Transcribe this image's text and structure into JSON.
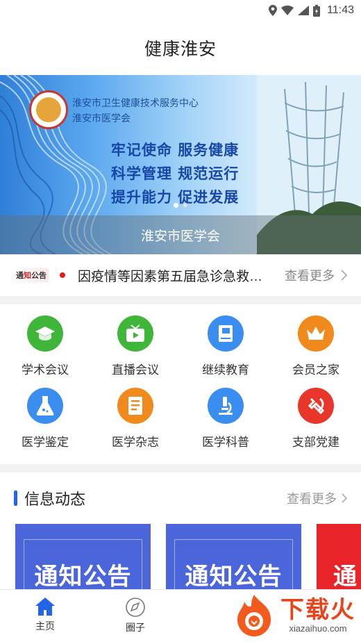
{
  "status_bar": {
    "time": "11:43"
  },
  "header": {
    "title": "健康淮安"
  },
  "banner": {
    "org_line1": "淮安市卫生健康技术服务中心",
    "org_line2": "淮安市医学会",
    "slogans": [
      "牢记使命  服务健康",
      "科学管理  规范运行",
      "提升能力  促进发展"
    ],
    "caption": "淮安市医学会",
    "active_slide": 1,
    "slide_count": 2
  },
  "notice": {
    "tag_part1": "通",
    "tag_part2": "知",
    "tag_part3": "公告",
    "text": "因疫情等因素第五届急诊急救大会延期举办的通知",
    "more": "查看更多"
  },
  "grid": [
    {
      "label": "学术会议",
      "icon": "graduation-cap-icon",
      "color": "#3fb63a"
    },
    {
      "label": "直播会议",
      "icon": "tv-play-icon",
      "color": "#3fb63a"
    },
    {
      "label": "继续教育",
      "icon": "book-icon",
      "color": "#3a8ef0"
    },
    {
      "label": "会员之家",
      "icon": "crown-icon",
      "color": "#f08a1c"
    },
    {
      "label": "医学鉴定",
      "icon": "flask-icon",
      "color": "#3a8ef0"
    },
    {
      "label": "医学杂志",
      "icon": "magazine-icon",
      "color": "#f08a1c"
    },
    {
      "label": "医学科普",
      "icon": "microscope-icon",
      "color": "#3a8ef0"
    },
    {
      "label": "支部党建",
      "icon": "party-emblem-icon",
      "color": "#e8362a"
    }
  ],
  "info": {
    "title": "信息动态",
    "more": "查看更多",
    "cards": [
      {
        "text": "通知公告",
        "color": "#4b66da"
      },
      {
        "text": "通知公告",
        "color": "#4b66da"
      },
      {
        "text": "通",
        "color": "#e8242a"
      }
    ]
  },
  "tabbar": {
    "home": "主页",
    "circle": "圈子"
  },
  "watermark": {
    "cn": "下载火",
    "en": "xiazaihuo.com"
  },
  "colors": {
    "accent": "#2166e8",
    "notice_red": "#e02020"
  }
}
